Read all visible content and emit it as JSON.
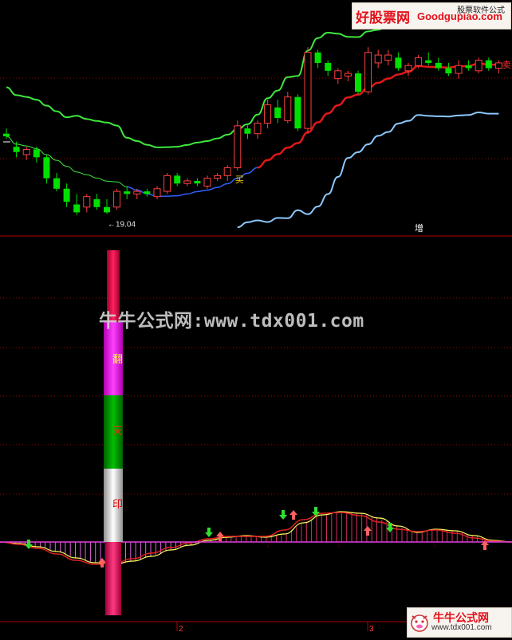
{
  "chart_data": [
    {
      "type": "candlestick",
      "panel": "main",
      "annotations": [
        {
          "text": "←19.04",
          "kind": "low-price-marker"
        },
        {
          "text": "买",
          "kind": "buy-signal"
        },
        {
          "text": "卖",
          "kind": "sell-signal"
        },
        {
          "text": "增",
          "kind": "label"
        }
      ],
      "bands": [
        "upper",
        "middle",
        "lower"
      ],
      "candles": [
        {
          "o": 22.1,
          "h": 22.3,
          "l": 21.9,
          "c": 22.0,
          "up": false
        },
        {
          "o": 21.6,
          "h": 21.8,
          "l": 21.2,
          "c": 21.4,
          "up": false
        },
        {
          "o": 21.3,
          "h": 21.6,
          "l": 21.1,
          "c": 21.5,
          "up": true
        },
        {
          "o": 21.5,
          "h": 21.6,
          "l": 21.0,
          "c": 21.2,
          "up": false
        },
        {
          "o": 21.2,
          "h": 21.3,
          "l": 20.2,
          "c": 20.4,
          "up": false
        },
        {
          "o": 20.4,
          "h": 20.6,
          "l": 19.9,
          "c": 20.0,
          "up": false
        },
        {
          "o": 20.0,
          "h": 20.2,
          "l": 19.3,
          "c": 19.5,
          "up": false
        },
        {
          "o": 19.4,
          "h": 19.8,
          "l": 19.0,
          "c": 19.1,
          "up": false
        },
        {
          "o": 19.3,
          "h": 19.8,
          "l": 19.1,
          "c": 19.7,
          "up": true
        },
        {
          "o": 19.6,
          "h": 19.8,
          "l": 19.2,
          "c": 19.3,
          "up": false
        },
        {
          "o": 19.3,
          "h": 19.6,
          "l": 19.04,
          "c": 19.1,
          "up": false
        },
        {
          "o": 19.3,
          "h": 20.0,
          "l": 19.2,
          "c": 19.9,
          "up": true
        },
        {
          "o": 19.9,
          "h": 20.1,
          "l": 19.6,
          "c": 19.8,
          "up": false
        },
        {
          "o": 19.8,
          "h": 20.0,
          "l": 19.6,
          "c": 19.9,
          "up": true
        },
        {
          "o": 19.9,
          "h": 20.0,
          "l": 19.7,
          "c": 19.8,
          "up": false
        },
        {
          "o": 19.7,
          "h": 20.1,
          "l": 19.6,
          "c": 20.0,
          "up": true
        },
        {
          "o": 19.9,
          "h": 20.6,
          "l": 19.8,
          "c": 20.5,
          "up": true
        },
        {
          "o": 20.5,
          "h": 20.6,
          "l": 20.1,
          "c": 20.2,
          "up": false
        },
        {
          "o": 20.2,
          "h": 20.4,
          "l": 20.1,
          "c": 20.3,
          "up": true
        },
        {
          "o": 20.3,
          "h": 20.4,
          "l": 20.1,
          "c": 20.2,
          "up": false
        },
        {
          "o": 20.1,
          "h": 20.5,
          "l": 20.0,
          "c": 20.4,
          "up": true
        },
        {
          "o": 20.4,
          "h": 20.6,
          "l": 20.3,
          "c": 20.5,
          "up": true
        },
        {
          "o": 20.5,
          "h": 20.9,
          "l": 20.3,
          "c": 20.8,
          "up": true
        },
        {
          "o": 20.8,
          "h": 22.6,
          "l": 20.7,
          "c": 22.4,
          "up": true
        },
        {
          "o": 22.3,
          "h": 22.5,
          "l": 21.9,
          "c": 22.1,
          "up": false
        },
        {
          "o": 22.1,
          "h": 22.6,
          "l": 21.9,
          "c": 22.5,
          "up": true
        },
        {
          "o": 22.5,
          "h": 23.4,
          "l": 22.3,
          "c": 23.2,
          "up": true
        },
        {
          "o": 23.1,
          "h": 23.4,
          "l": 22.5,
          "c": 22.7,
          "up": false
        },
        {
          "o": 22.6,
          "h": 23.7,
          "l": 22.5,
          "c": 23.5,
          "up": true
        },
        {
          "o": 23.5,
          "h": 23.6,
          "l": 22.2,
          "c": 22.3,
          "up": false
        },
        {
          "o": 22.3,
          "h": 25.4,
          "l": 22.1,
          "c": 25.2,
          "up": true
        },
        {
          "o": 25.2,
          "h": 25.3,
          "l": 24.6,
          "c": 24.8,
          "up": false
        },
        {
          "o": 24.8,
          "h": 24.9,
          "l": 24.3,
          "c": 24.5,
          "up": false
        },
        {
          "o": 24.5,
          "h": 24.6,
          "l": 24.0,
          "c": 24.2,
          "up": true
        },
        {
          "o": 24.3,
          "h": 24.5,
          "l": 24.1,
          "c": 24.4,
          "up": true
        },
        {
          "o": 24.4,
          "h": 24.5,
          "l": 23.6,
          "c": 23.7,
          "up": false
        },
        {
          "o": 23.7,
          "h": 25.4,
          "l": 23.6,
          "c": 25.2,
          "up": true
        },
        {
          "o": 25.1,
          "h": 25.3,
          "l": 24.6,
          "c": 24.8,
          "up": true
        },
        {
          "o": 24.9,
          "h": 25.3,
          "l": 24.7,
          "c": 25.1,
          "up": true
        },
        {
          "o": 25.0,
          "h": 25.2,
          "l": 24.5,
          "c": 24.6,
          "up": false
        },
        {
          "o": 24.5,
          "h": 24.8,
          "l": 24.3,
          "c": 24.7,
          "up": true
        },
        {
          "o": 24.7,
          "h": 25.1,
          "l": 24.6,
          "c": 25.0,
          "up": true
        },
        {
          "o": 24.9,
          "h": 25.2,
          "l": 24.7,
          "c": 24.8,
          "up": false
        },
        {
          "o": 24.8,
          "h": 25.0,
          "l": 24.5,
          "c": 24.6,
          "up": false
        },
        {
          "o": 24.6,
          "h": 24.8,
          "l": 24.3,
          "c": 24.4,
          "up": false
        },
        {
          "o": 24.4,
          "h": 24.9,
          "l": 24.2,
          "c": 24.7,
          "up": true
        },
        {
          "o": 24.7,
          "h": 24.9,
          "l": 24.5,
          "c": 24.6,
          "up": false
        },
        {
          "o": 24.5,
          "h": 25.0,
          "l": 24.4,
          "c": 24.9,
          "up": true
        },
        {
          "o": 24.9,
          "h": 25.0,
          "l": 24.5,
          "c": 24.6,
          "up": false
        },
        {
          "o": 24.6,
          "h": 24.9,
          "l": 24.4,
          "c": 24.8,
          "up": true
        }
      ]
    },
    {
      "type": "indicator",
      "panel": "sub",
      "bar_labels": [
        "翻",
        "天",
        "印"
      ],
      "x_ticks": [
        "2",
        "3"
      ]
    }
  ],
  "watermark": "牛牛公式网:www.tdx001.com",
  "logo_top": {
    "cn": "好股票网",
    "en": "Goodgupiao.com",
    "small": "股票软件公式"
  },
  "logo_bottom": {
    "cn": "牛牛公式网",
    "url": "www.tdx001.com"
  },
  "colors": {
    "up": "#ff4040",
    "down": "#00e000",
    "upper_band": "#3ee83e",
    "mid_band": "#e01818",
    "lower_band": "#8cc8ff",
    "grid": "#a00000"
  }
}
